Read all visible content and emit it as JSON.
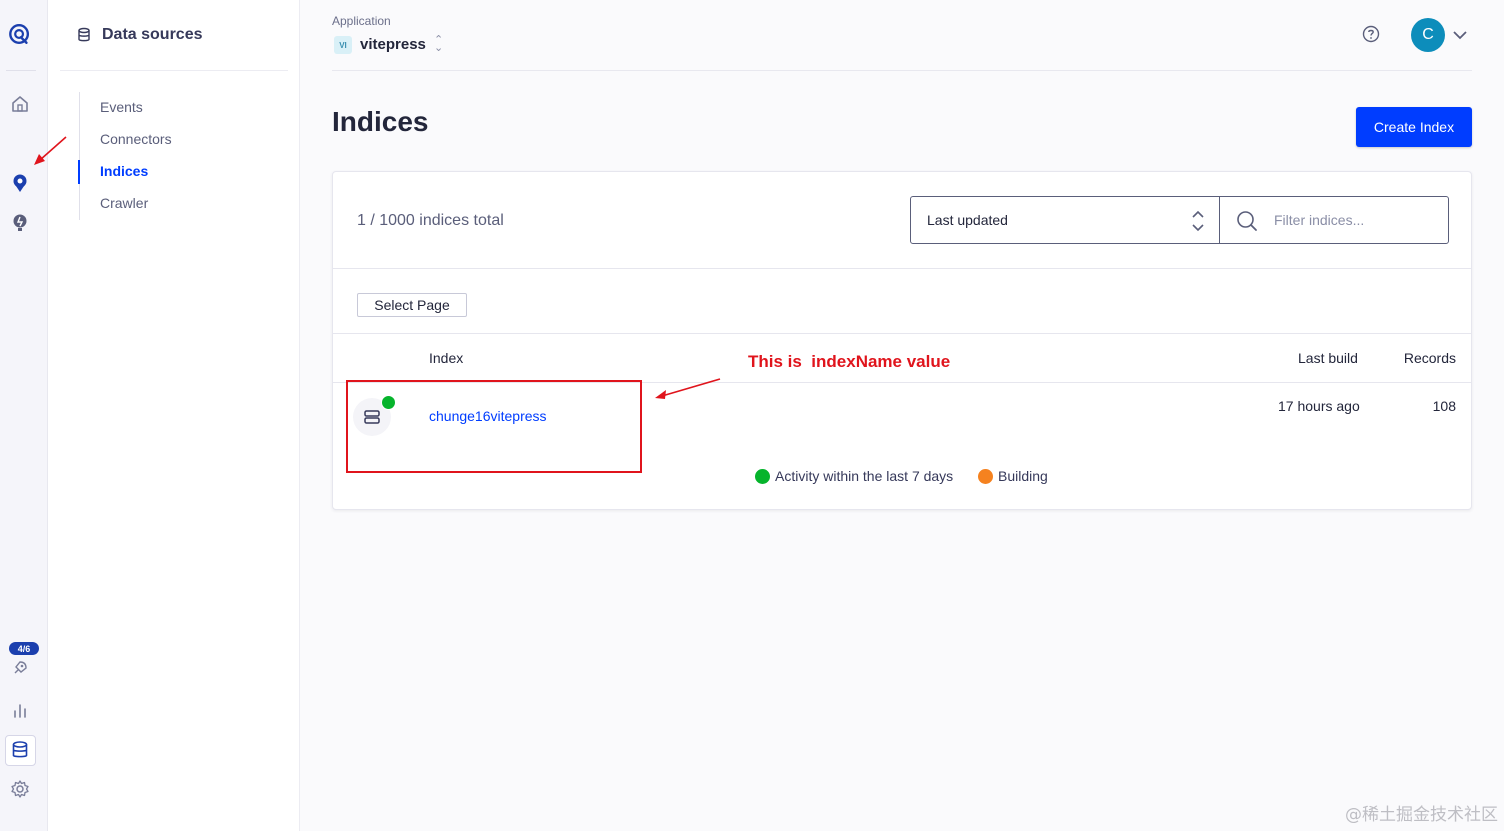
{
  "subnav": {
    "title": "Data sources",
    "items": [
      {
        "label": "Events"
      },
      {
        "label": "Connectors"
      },
      {
        "label": "Indices"
      },
      {
        "label": "Crawler"
      }
    ]
  },
  "rail": {
    "badge": "4/6",
    "icons": [
      "algolia-logo-icon",
      "home-icon",
      "search-pin-icon",
      "bulb-icon",
      "rocket-icon",
      "chart-icon",
      "database-icon",
      "gear-icon"
    ]
  },
  "topbar": {
    "caption": "Application",
    "app_chip": "VI",
    "app_name": "vitepress",
    "avatar_letter": "C"
  },
  "page": {
    "title": "Indices",
    "create_button": "Create Index"
  },
  "card": {
    "total": "1 / 1000 indices total",
    "sort_value": "Last updated",
    "filter_placeholder": "Filter indices...",
    "select_page": "Select Page",
    "columns": {
      "index": "Index",
      "last_build": "Last build",
      "records": "Records"
    },
    "rows": [
      {
        "name": "chunge16vitepress",
        "last_build": "17 hours ago",
        "records": "108",
        "status_color": "#06b42c"
      }
    ],
    "legend": [
      {
        "label": "Activity within the last 7 days",
        "color": "#06b42c"
      },
      {
        "label": "Building",
        "color": "#f5821f"
      }
    ]
  },
  "annotation": {
    "text": "This is  indexName value",
    "color": "#e0141c"
  },
  "watermark": "@稀土掘金技术社区",
  "colors": {
    "accent": "#003dff",
    "rail_bg": "#f5f5fa"
  }
}
